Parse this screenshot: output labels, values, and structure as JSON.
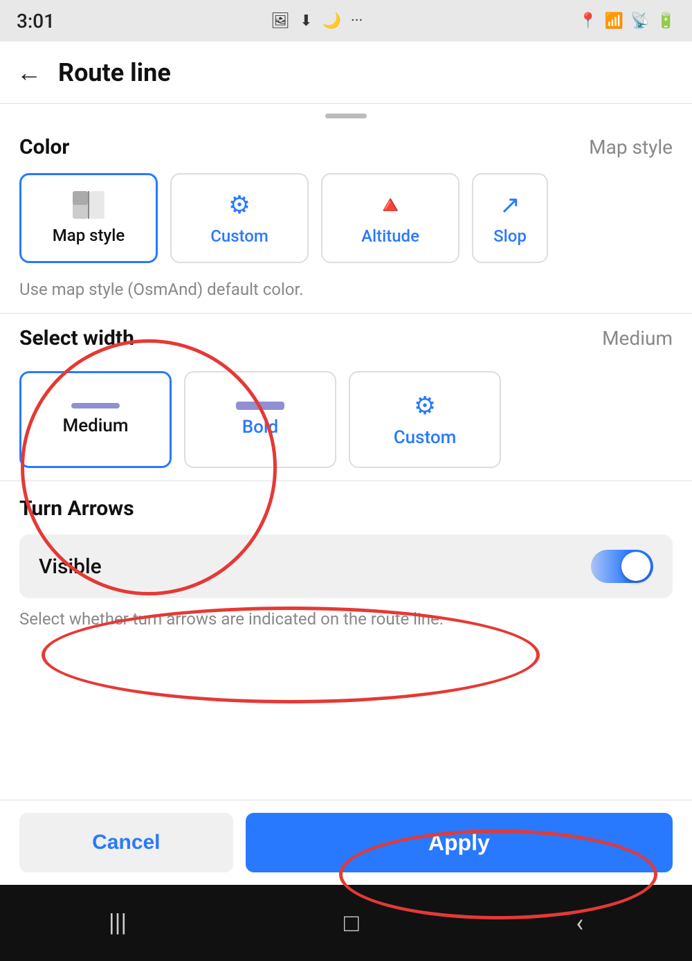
{
  "statusBar": {
    "time": "3:01",
    "icons": [
      "🖼",
      "⬇",
      "🌙",
      "···"
    ],
    "rightIcons": [
      "📍",
      "WiFi",
      "Signal",
      "🔋"
    ]
  },
  "header": {
    "backLabel": "←",
    "title": "Route line"
  },
  "colorSection": {
    "sectionTitle": "Color",
    "sectionValue": "Map style",
    "options": [
      {
        "id": "map-style",
        "label": "Map style",
        "selected": true
      },
      {
        "id": "custom",
        "label": "Custom",
        "selected": false
      },
      {
        "id": "altitude",
        "label": "Altitude",
        "selected": false
      },
      {
        "id": "slope",
        "label": "Slop",
        "selected": false,
        "partial": true
      }
    ],
    "description": "Use map style (OsmAnd) default color."
  },
  "widthSection": {
    "sectionTitle": "Select width",
    "sectionValue": "Medium",
    "options": [
      {
        "id": "medium",
        "label": "Medium",
        "selected": true
      },
      {
        "id": "bold",
        "label": "Bold",
        "selected": false
      },
      {
        "id": "custom",
        "label": "Custom",
        "selected": false
      }
    ]
  },
  "turnArrowsSection": {
    "sectionTitle": "Turn Arrows",
    "visibleLabel": "Visible",
    "toggleOn": true,
    "description": "Select whether turn arrows are indicated on the route line."
  },
  "bottomBar": {
    "cancelLabel": "Cancel",
    "applyLabel": "Apply"
  },
  "navBar": {
    "icons": [
      "|||",
      "□",
      "‹"
    ]
  }
}
